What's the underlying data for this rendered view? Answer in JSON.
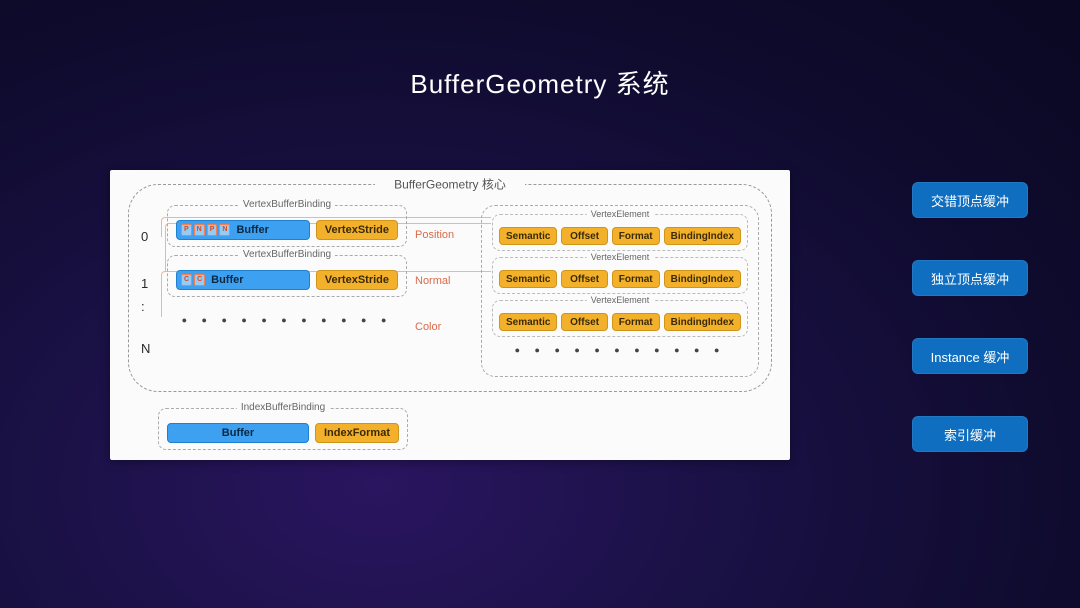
{
  "title": "BufferGeometry 系统",
  "sidebar": {
    "items": [
      {
        "label": "交错顶点缓冲"
      },
      {
        "label": "独立顶点缓冲"
      },
      {
        "label": "Instance 缓冲"
      },
      {
        "label": "索引缓冲"
      }
    ]
  },
  "diagram": {
    "core_title": "BufferGeometry 核心",
    "indices": [
      "0",
      "1",
      ":",
      "N"
    ],
    "vertex_buffer_binding": {
      "title": "VertexBufferBinding",
      "buffer_label": "Buffer",
      "stride_label": "VertexStride",
      "mini_tags_interleaved": [
        "P",
        "N",
        "P",
        "N"
      ],
      "mini_tags_separate": [
        "C",
        "C"
      ]
    },
    "mid_labels": [
      "Position",
      "Normal",
      "Color"
    ],
    "vertex_element": {
      "title": "VertexElement",
      "fields": [
        "Semantic",
        "Offset",
        "Format",
        "BindingIndex"
      ]
    },
    "index_buffer_binding": {
      "title": "IndexBufferBinding",
      "buffer_label": "Buffer",
      "format_label": "IndexFormat"
    },
    "ellipsis": "● ● ● ● ● ● ● ● ● ● ●"
  }
}
